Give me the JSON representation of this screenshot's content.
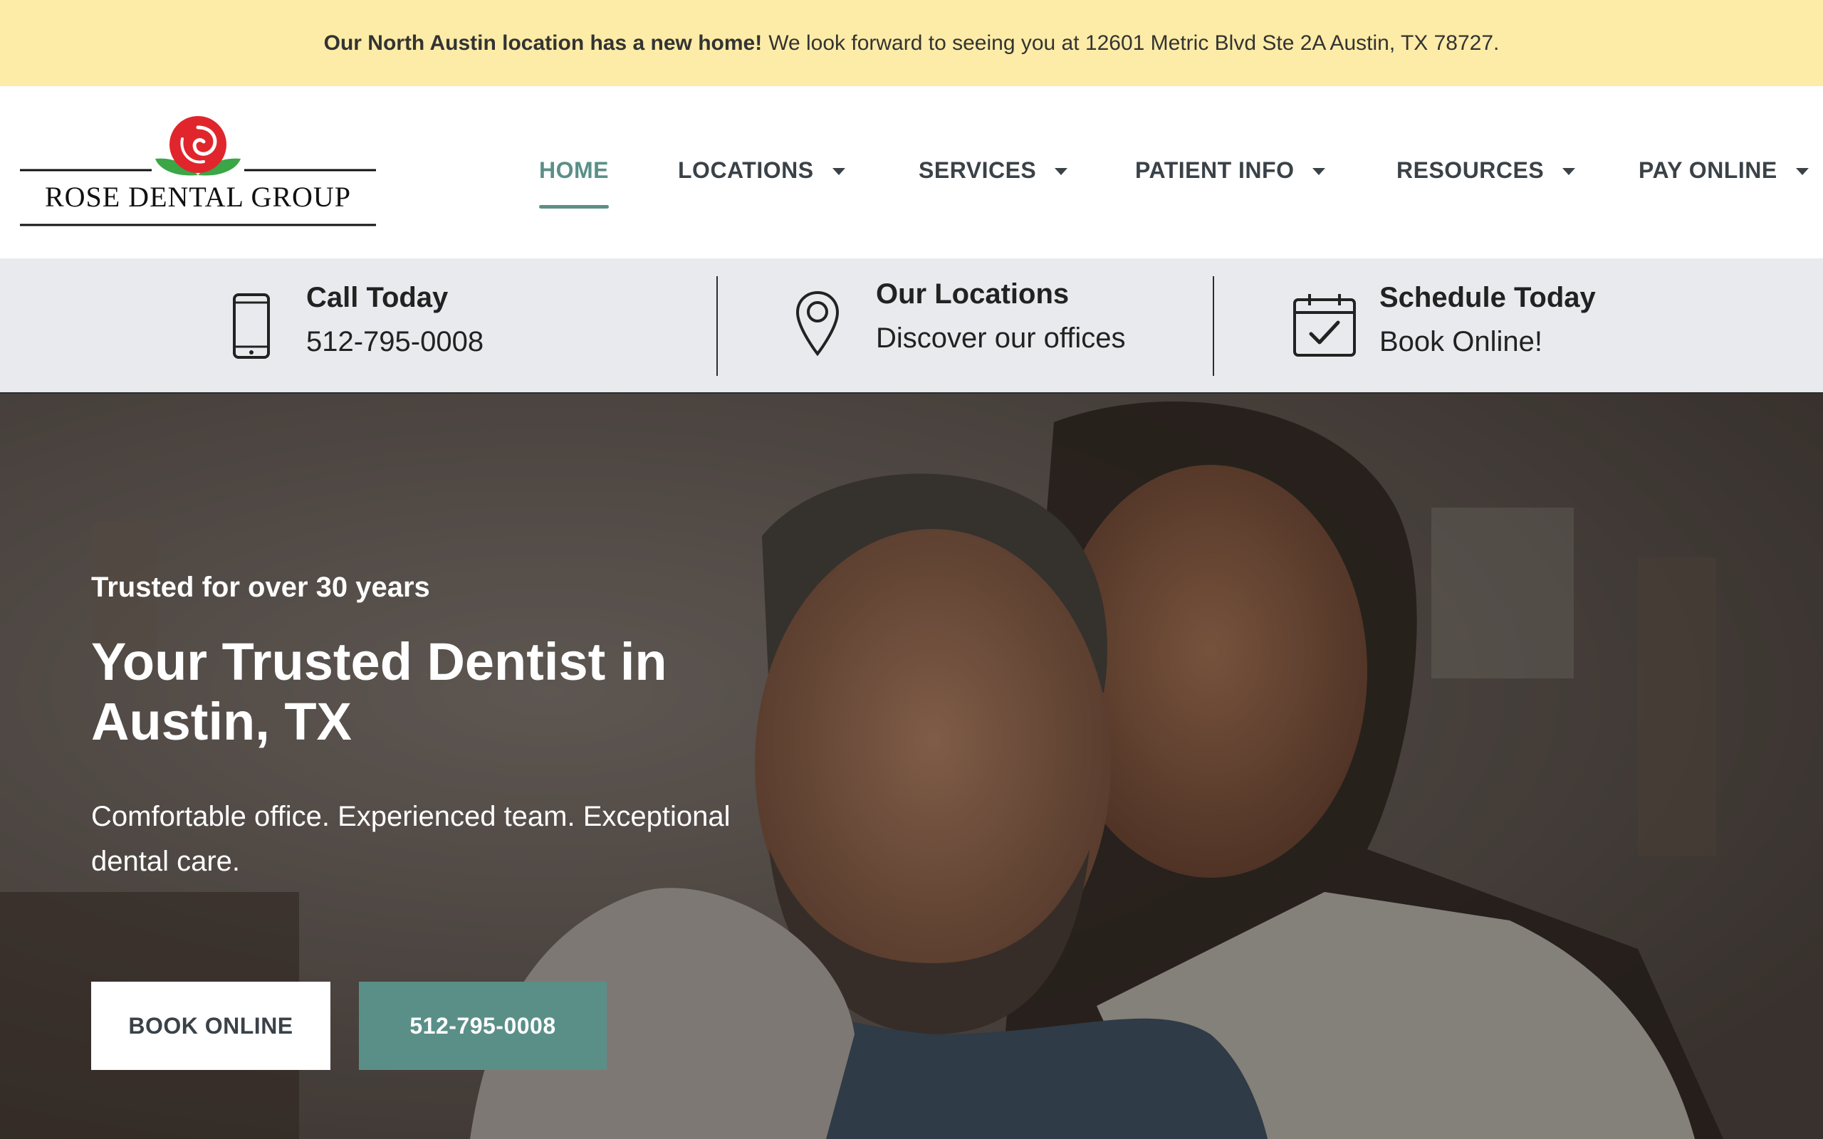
{
  "announcement": {
    "bold": "Our North Austin location has a new home!",
    "text": "We look forward to seeing you at 12601 Metric Blvd Ste 2A Austin, TX 78727."
  },
  "logo": {
    "text": "ROSE DENTAL GROUP"
  },
  "nav": {
    "items": [
      {
        "label": "HOME",
        "active": true
      },
      {
        "label": "LOCATIONS",
        "dropdown": true
      },
      {
        "label": "SERVICES",
        "dropdown": true
      },
      {
        "label": "PATIENT INFO",
        "dropdown": true
      },
      {
        "label": "RESOURCES",
        "dropdown": true
      },
      {
        "label": "PAY ONLINE",
        "dropdown": true
      }
    ]
  },
  "infobar": {
    "call": {
      "title": "Call Today",
      "sub": "512-795-0008",
      "icon": "phone-icon"
    },
    "locations": {
      "title": "Our Locations",
      "sub": "Discover our offices",
      "icon": "map-pin-icon"
    },
    "schedule": {
      "title": "Schedule Today",
      "sub": "Book Online!",
      "icon": "calendar-check-icon"
    }
  },
  "hero": {
    "eyebrow": "Trusted for over 30 years",
    "headline": "Your Trusted Dentist in Austin, TX",
    "lead": "Comfortable office. Experienced team. Exceptional dental care.",
    "book_label": "BOOK ONLINE",
    "call_label": "512-795-0008"
  },
  "colors": {
    "announcement_bg": "#fdeca7",
    "accent": "#5a8f88",
    "nav_text": "#3a4248",
    "infobar_bg": "#e9eaed"
  }
}
